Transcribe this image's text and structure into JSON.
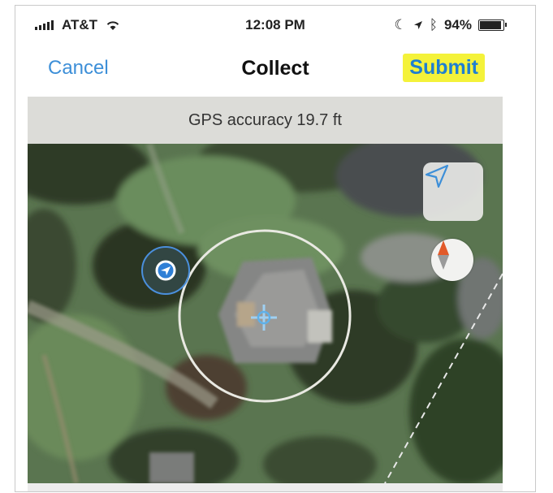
{
  "status_bar": {
    "carrier": "AT&T",
    "time": "12:08 PM",
    "battery": "94%"
  },
  "nav": {
    "cancel_label": "Cancel",
    "title": "Collect",
    "submit_label": "Submit"
  },
  "gps": {
    "accuracy_text": "GPS accuracy 19.7 ft"
  },
  "map": {
    "icons": [
      "location-arrow-icon",
      "compass-icon",
      "current-location-marker-icon",
      "crosshair-icon"
    ]
  },
  "colors": {
    "accent_blue": "#3d8fd8",
    "highlight_yellow": "#f4f23a",
    "gps_bar": "#dcdcd8"
  }
}
